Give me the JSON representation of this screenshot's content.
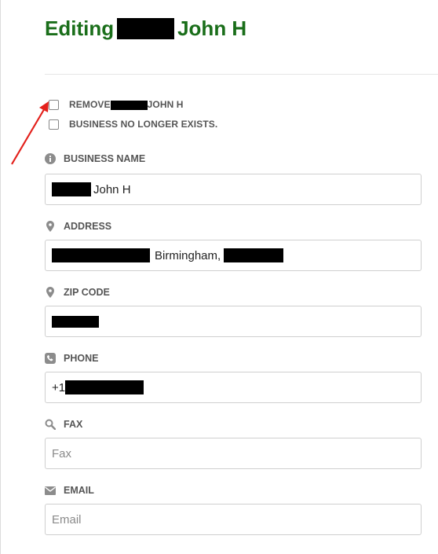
{
  "header": {
    "title_prefix": "Editing",
    "title_suffix": "John H"
  },
  "checkboxes": [
    {
      "label_prefix": "REMOVE",
      "label_suffix": "JOHN H",
      "checked": false
    },
    {
      "label": "BUSINESS NO LONGER EXISTS.",
      "checked": false
    }
  ],
  "fields": {
    "business_name": {
      "label": "BUSINESS NAME",
      "icon": "info-icon",
      "value_suffix": "John H"
    },
    "address": {
      "label": "ADDRESS",
      "icon": "map-pin-icon",
      "value_middle": "Birmingham,"
    },
    "zip_code": {
      "label": "ZIP CODE",
      "icon": "map-pin-icon"
    },
    "phone": {
      "label": "PHONE",
      "icon": "phone-icon",
      "value_prefix": "+1"
    },
    "fax": {
      "label": "FAX",
      "icon": "search-icon",
      "placeholder": "Fax"
    },
    "email": {
      "label": "EMAIL",
      "icon": "envelope-icon",
      "placeholder": "Email"
    }
  },
  "colors": {
    "title": "#1a6e1a",
    "annotation_arrow": "#e3201b",
    "redaction": "#000000"
  }
}
